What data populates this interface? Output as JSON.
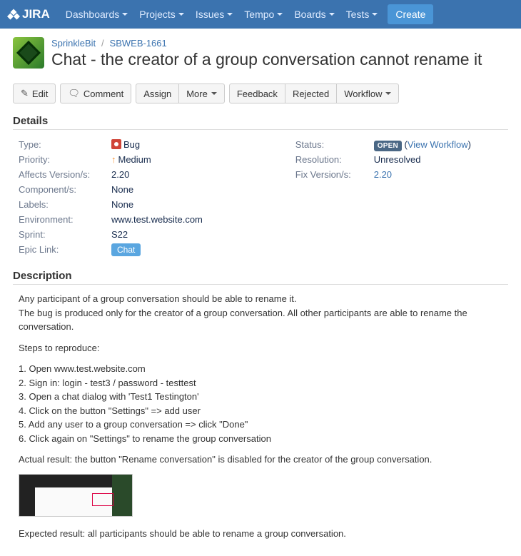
{
  "nav": {
    "logo": "JIRA",
    "items": [
      "Dashboards",
      "Projects",
      "Issues",
      "Tempo",
      "Boards",
      "Tests"
    ],
    "create": "Create"
  },
  "breadcrumb": {
    "project": "SprinkleBit",
    "key": "SBWEB-1661"
  },
  "summary": "Chat - the creator of a group conversation cannot rename it",
  "toolbar": {
    "edit": "Edit",
    "comment": "Comment",
    "assign": "Assign",
    "more": "More",
    "feedback": "Feedback",
    "rejected": "Rejected",
    "workflow": "Workflow"
  },
  "sections": {
    "details": "Details",
    "description": "Description"
  },
  "fields": {
    "type_label": "Type:",
    "type_value": "Bug",
    "priority_label": "Priority:",
    "priority_value": "Medium",
    "affects_label": "Affects Version/s:",
    "affects_value": "2.20",
    "components_label": "Component/s:",
    "components_value": "None",
    "labels_label": "Labels:",
    "labels_value": "None",
    "environment_label": "Environment:",
    "environment_value": "www.test.website.com",
    "sprint_label": "Sprint:",
    "sprint_value": "S22",
    "epic_label": "Epic Link:",
    "epic_value": "Chat",
    "status_label": "Status:",
    "status_value": "OPEN",
    "view_workflow": "View Workflow",
    "resolution_label": "Resolution:",
    "resolution_value": "Unresolved",
    "fixversion_label": "Fix Version/s:",
    "fixversion_value": "2.20"
  },
  "description": {
    "p1": "Any participant of a group conversation should be able to rename it.",
    "p2": "The bug is produced only for the creator of a group conversation. All other participants are able to rename the conversation.",
    "steps_h": "Steps to reproduce:",
    "s1": "1. Open www.test.website.com",
    "s2": "2. Sign in: login - test3 / password - testtest",
    "s3": "3. Open a chat dialog with 'Test1 Testington'",
    "s4": "4. Click on the button \"Settings\" => add user",
    "s5": "5. Add any user to a group conversation => click \"Done\"",
    "s6": "6. Click again on \"Settings\" to rename the group conversation",
    "actual": "Actual result: the button \"Rename conversation\" is disabled for the creator of the group conversation.",
    "expected": "Expected result: all participants should be able to rename a group conversation."
  }
}
